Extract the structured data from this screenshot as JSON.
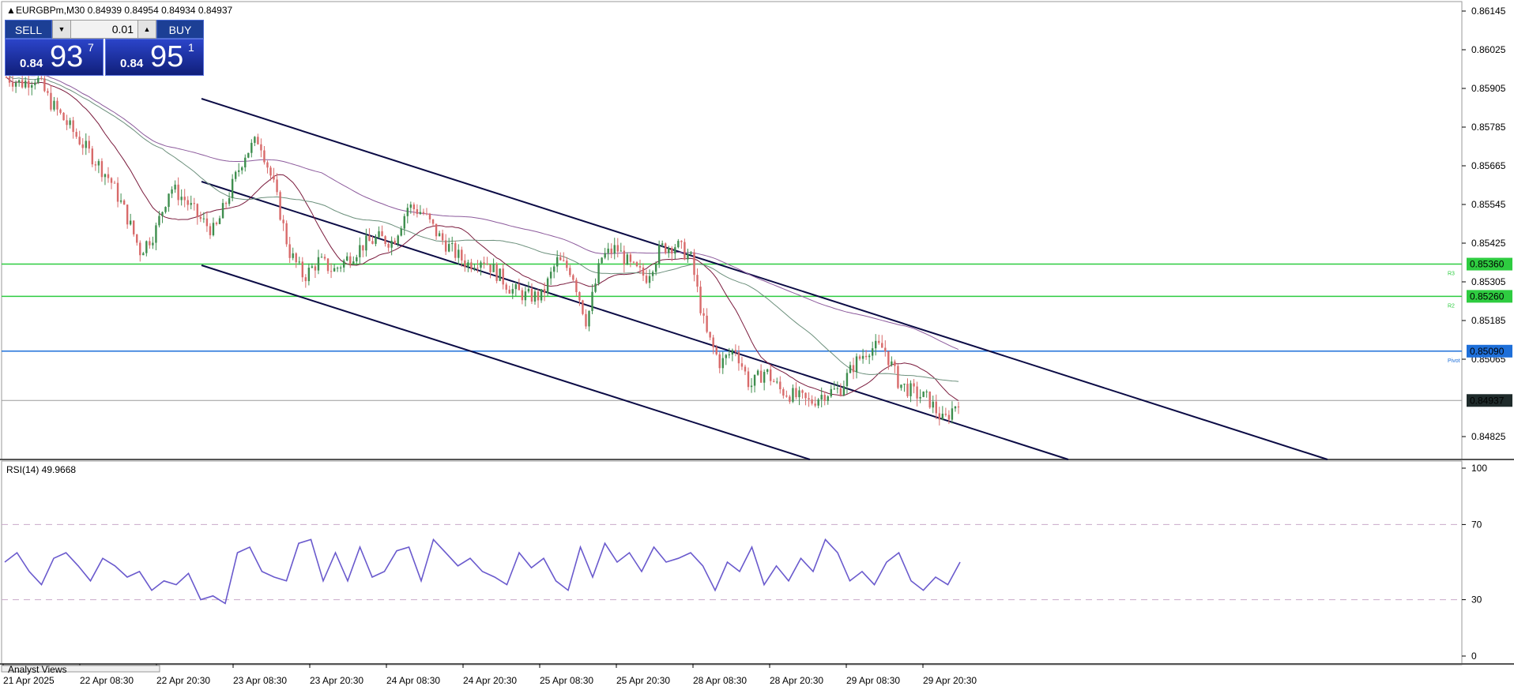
{
  "header": {
    "text": "EURGBPm,M30  0.84939 0.84954 0.84934 0.84937",
    "arrow": "▲"
  },
  "trade_panel": {
    "sell_label": "SELL",
    "buy_label": "BUY",
    "lot": "0.01",
    "sell_price_small": "0.84",
    "sell_price_big": "93",
    "sell_price_sup": "7",
    "buy_price_small": "0.84",
    "buy_price_big": "95",
    "buy_price_sup": "1",
    "sell_color": "#1c3f95"
  },
  "chart_data": [
    {
      "type": "candlestick",
      "symbol": "EURGBPm",
      "timeframe": "M30",
      "x_tick_labels": [
        "21 Apr 2025",
        "22 Apr 08:30",
        "22 Apr 20:30",
        "23 Apr 08:30",
        "23 Apr 20:30",
        "24 Apr 08:30",
        "24 Apr 20:30",
        "25 Apr 08:30",
        "25 Apr 20:30",
        "28 Apr 08:30",
        "28 Apr 20:30",
        "29 Apr 08:30",
        "29 Apr 20:30"
      ],
      "y_ticks": [
        0.86145,
        0.86025,
        0.85905,
        0.85785,
        0.85665,
        0.85545,
        0.85425,
        0.85305,
        0.85185,
        0.85065,
        0.84825
      ],
      "ylim": [
        0.84795,
        0.86165
      ],
      "close_path": [
        0.8594,
        0.8592,
        0.8594,
        0.8586,
        0.858,
        0.8574,
        0.8568,
        0.8562,
        0.8552,
        0.854,
        0.8546,
        0.856,
        0.8556,
        0.855,
        0.8546,
        0.8558,
        0.857,
        0.8575,
        0.856,
        0.854,
        0.8532,
        0.8537,
        0.8534,
        0.8538,
        0.8542,
        0.8544,
        0.8543,
        0.8554,
        0.8552,
        0.8545,
        0.854,
        0.8536,
        0.8538,
        0.8533,
        0.8528,
        0.8526,
        0.8526,
        0.8537,
        0.8534,
        0.8518,
        0.8538,
        0.8541,
        0.8535,
        0.8532,
        0.8541,
        0.8542,
        0.8538,
        0.8515,
        0.8505,
        0.851,
        0.8498,
        0.8503,
        0.8497,
        0.8495,
        0.8493,
        0.8496,
        0.8497,
        0.8505,
        0.851,
        0.851,
        0.8499,
        0.8496,
        0.8494,
        0.8487,
        0.8494
      ],
      "bid_line": 0.84937,
      "levels": [
        {
          "price": "0.85360",
          "value": 0.8536,
          "color": "#2ecc40",
          "tag": "R3"
        },
        {
          "price": "0.85260",
          "value": 0.8526,
          "color": "#2ecc40",
          "tag": "R2"
        },
        {
          "price": "0.85090",
          "value": 0.8509,
          "color": "#1e6fd9",
          "tag": "Pivot"
        }
      ],
      "current_price_label": "0.84937",
      "moving_averages": [
        {
          "color": "#7a1a3c"
        },
        {
          "color": "#6b8f7b"
        },
        {
          "color": "#8c5a9c"
        }
      ]
    },
    {
      "type": "line",
      "indicator": "RSI(14)",
      "title": "RSI(14) 49.9668",
      "ylim": [
        0,
        100
      ],
      "y_ticks": [
        100,
        70,
        30,
        0
      ],
      "levels": [
        70,
        30
      ],
      "color": "#6a5acd",
      "values": [
        50,
        55,
        45,
        38,
        52,
        55,
        48,
        40,
        52,
        48,
        42,
        45,
        35,
        40,
        38,
        44,
        30,
        32,
        28,
        55,
        58,
        45,
        42,
        40,
        60,
        62,
        40,
        55,
        40,
        58,
        42,
        45,
        56,
        58,
        40,
        62,
        55,
        48,
        52,
        45,
        42,
        38,
        55,
        47,
        52,
        40,
        35,
        58,
        42,
        60,
        50,
        55,
        45,
        58,
        50,
        52,
        55,
        48,
        35,
        50,
        45,
        58,
        38,
        48,
        40,
        52,
        45,
        62,
        55,
        40,
        45,
        38,
        50,
        55,
        40,
        35,
        42,
        38,
        50
      ]
    }
  ],
  "analyst_views_label": "Analyst Views"
}
